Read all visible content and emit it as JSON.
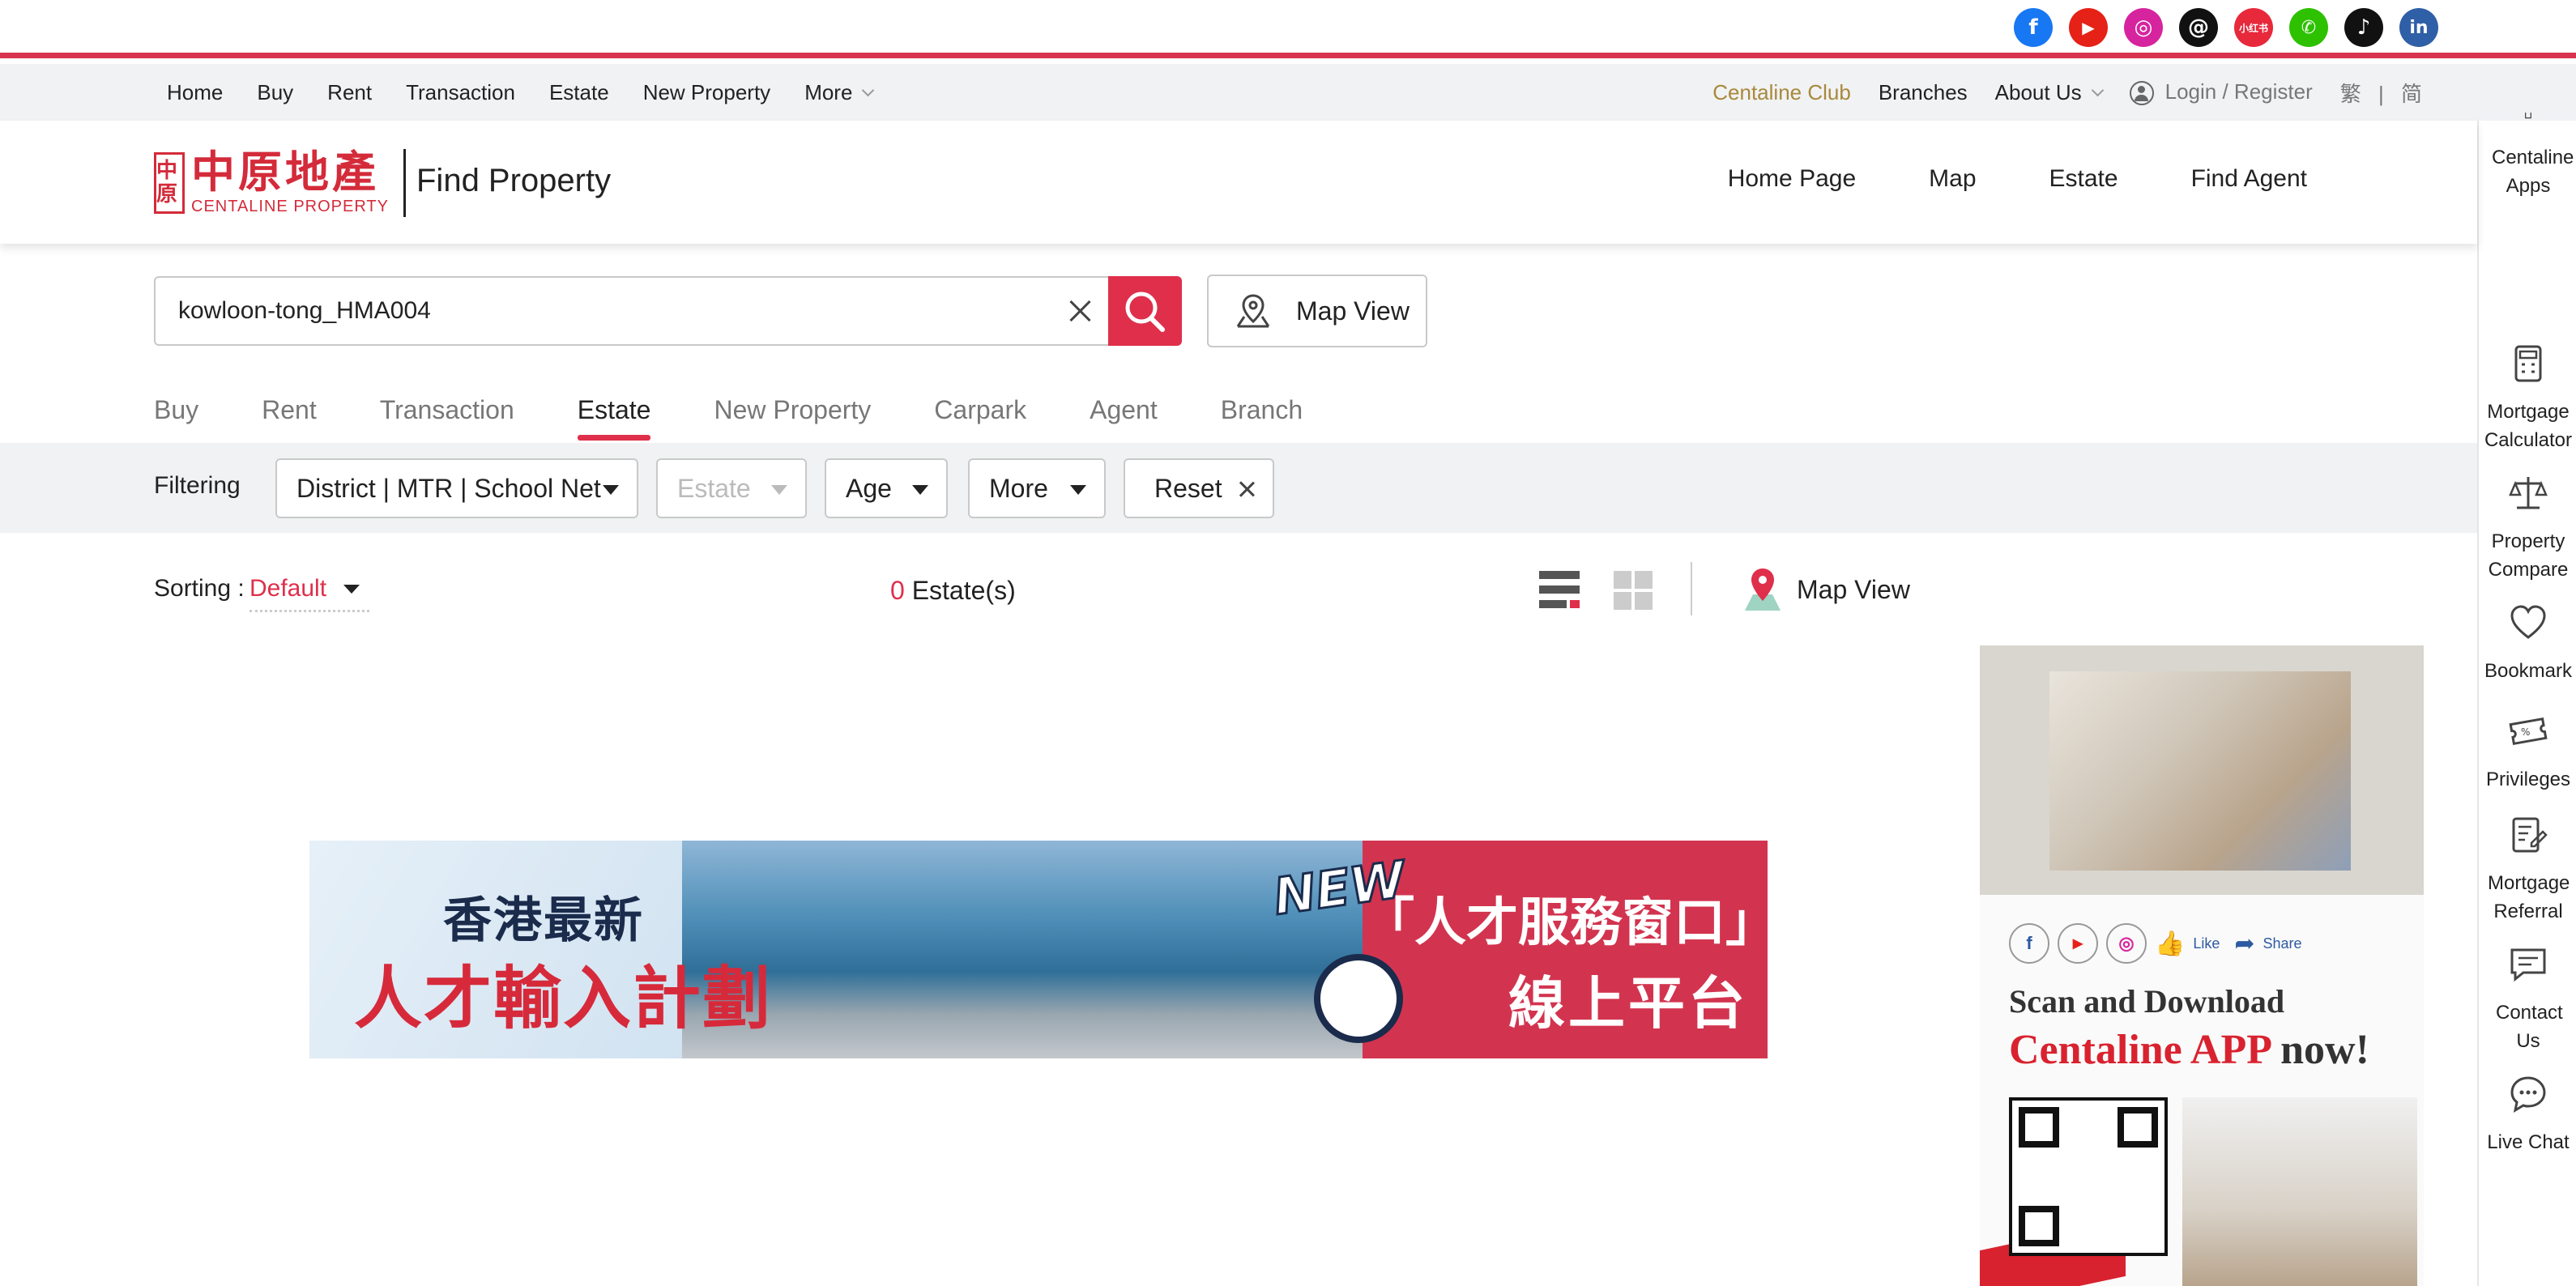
{
  "social": [
    {
      "icon": "facebook-icon",
      "glyph": "f",
      "color": "#1877f2"
    },
    {
      "icon": "youtube-icon",
      "glyph": "▶",
      "color": "#e62117"
    },
    {
      "icon": "instagram-icon",
      "glyph": "◎",
      "color": "#d6249f"
    },
    {
      "icon": "threads-icon",
      "glyph": "@",
      "color": "#111111"
    },
    {
      "icon": "xiaohongshu-icon",
      "glyph": "小红书",
      "color": "#e8283b"
    },
    {
      "icon": "wechat-icon",
      "glyph": "✆",
      "color": "#2dc100"
    },
    {
      "icon": "tiktok-icon",
      "glyph": "♪",
      "color": "#111111"
    },
    {
      "icon": "linkedin-icon",
      "glyph": "in",
      "color": "#2f5fa7"
    }
  ],
  "topnav": {
    "left": [
      "Home",
      "Buy",
      "Rent",
      "Transaction",
      "Estate",
      "New Property",
      "More"
    ],
    "club": "Centaline Club",
    "branches": "Branches",
    "about": "About Us",
    "login": "Login / Register",
    "lang_trad": "繁",
    "lang_sep": "|",
    "lang_simp": "简"
  },
  "header": {
    "logo_seal": "中原",
    "logo_cn": "中原地產",
    "logo_en": "CENTALINE PROPERTY",
    "section": "Find Property",
    "nav": [
      "Home Page",
      "Map",
      "Estate",
      "Find Agent"
    ]
  },
  "search": {
    "value": "kowloon-tong_HMA004",
    "map_view": "Map View"
  },
  "tabs": [
    "Buy",
    "Rent",
    "Transaction",
    "Estate",
    "New Property",
    "Carpark",
    "Agent",
    "Branch"
  ],
  "active_tab": "Estate",
  "filter": {
    "label": "Filtering",
    "district": "District | MTR | School Net",
    "estate": "Estate",
    "age": "Age",
    "more": "More",
    "reset": "Reset"
  },
  "results": {
    "sorting_label": "Sorting :",
    "sorting_value": "Default",
    "count": "0",
    "count_label": "Estate(s)",
    "map_view": "Map View"
  },
  "banner": {
    "line1": "香港最新",
    "line2": "人才輸入計劃",
    "new": "NEW",
    "line3": "「人才服務窗口」",
    "line4": "線上平台"
  },
  "ad": {
    "like": "Like",
    "share": "Share",
    "headline1": "Scan and Download",
    "headline2_brand": "Centaline APP",
    "headline2_rest": " now!"
  },
  "sidebar": [
    {
      "label": "Centaline Apps",
      "icon": "phone-icon"
    },
    {
      "label": "Mortgage Calculator",
      "icon": "calculator-icon"
    },
    {
      "label": "Property Compare",
      "icon": "scale-icon"
    },
    {
      "label": "Bookmark",
      "icon": "heart-icon"
    },
    {
      "label": "Privileges",
      "icon": "ticket-icon"
    },
    {
      "label": "Mortgage Referral",
      "icon": "document-edit-icon"
    },
    {
      "label": "Contact Us",
      "icon": "message-icon"
    },
    {
      "label": "Live Chat",
      "icon": "chat-bubble-icon"
    }
  ],
  "colors": {
    "brand_red": "#df2f4b",
    "club_gold": "#a8893b"
  }
}
